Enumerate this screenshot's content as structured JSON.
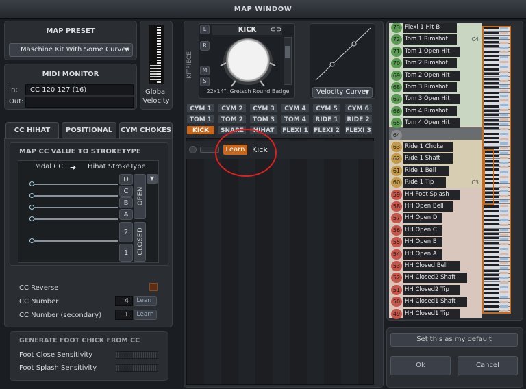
{
  "window": {
    "title": "MAP WINDOW"
  },
  "map_preset": {
    "header": "MAP PRESET",
    "selected": "Maschine Kit With Some Curves"
  },
  "midi_monitor": {
    "header": "MIDI MONITOR",
    "in_label": "In:",
    "in_value": "CC 120 127 (16)",
    "out_label": "Out:",
    "out_value": ""
  },
  "global_velocity": {
    "label_line1": "Global",
    "label_line2": "Velocity"
  },
  "tabs": [
    {
      "label": "CC HIHAT"
    },
    {
      "label": "POSITIONAL"
    },
    {
      "label": "CYM CHOKES"
    }
  ],
  "cc_map": {
    "header": "MAP CC VALUE TO STROKETYPE",
    "pedal_label": "Pedal CC",
    "hihat_label": "Hihat StrokeType",
    "letters": [
      "D",
      "C",
      "B",
      "A"
    ],
    "numbers": [
      "2",
      "1"
    ],
    "open_label": "OPEN",
    "closed_label": "CLOSED"
  },
  "cc_reverse": {
    "label": "CC Reverse"
  },
  "cc_number": {
    "label": "CC Number",
    "value": "4",
    "learn": "Learn"
  },
  "cc_number_secondary": {
    "label": "CC Number (secondary)",
    "value": "1",
    "learn": "Learn"
  },
  "foot_chick": {
    "header": "GENERATE FOOT CHICK FROM CC",
    "close_label": "Foot Close Sensitivity",
    "splash_label": "Foot Splash Sensitivity"
  },
  "kitpiece": {
    "label": "KITPIECE",
    "name": "KICK",
    "desc": "22x14\", Gretsch Round Badge",
    "buttons": [
      "L",
      "R",
      "M",
      "S"
    ]
  },
  "velocity_curve": {
    "label": "Velocity Curve"
  },
  "kit_buttons": {
    "row1": [
      "CYM 1",
      "CYM 2",
      "CYM 3",
      "CYM 4",
      "CYM 5",
      "CYM 6"
    ],
    "row2": [
      "TOM 1",
      "TOM 2",
      "TOM 3",
      "TOM 4",
      "RIDE 1",
      "RIDE 2"
    ],
    "row3": [
      "KICK",
      "SNARE",
      "HIHAT",
      "FLEXI 1",
      "FLEXI 2",
      "FLEXI 3"
    ]
  },
  "mapping_list": {
    "learn": "Learn",
    "entry": "Kick"
  },
  "note_map": [
    {
      "num": "73",
      "name": "Flexi 1 Hit B",
      "oct": ""
    },
    {
      "num": "72",
      "name": "Tom 1 Rimshot",
      "oct": "C4"
    },
    {
      "num": "71",
      "name": "Tom 1 Open Hit",
      "oct": ""
    },
    {
      "num": "70",
      "name": "Tom 2 Rimshot",
      "oct": ""
    },
    {
      "num": "69",
      "name": "Tom 2 Open Hit",
      "oct": ""
    },
    {
      "num": "68",
      "name": "Tom 3 Rimshot",
      "oct": ""
    },
    {
      "num": "67",
      "name": "Tom 3 Open Hit",
      "oct": ""
    },
    {
      "num": "66",
      "name": "Tom 4 Rimshot",
      "oct": ""
    },
    {
      "num": "65",
      "name": "Tom 4 Open Hit",
      "oct": ""
    },
    {
      "num": "64",
      "name": "",
      "oct": ""
    },
    {
      "num": "63",
      "name": "Ride 1 Choke",
      "oct": ""
    },
    {
      "num": "62",
      "name": "Ride 1 Shaft",
      "oct": ""
    },
    {
      "num": "61",
      "name": "Ride 1 Bell",
      "oct": ""
    },
    {
      "num": "60",
      "name": "Ride 1 Tip",
      "oct": "C3"
    },
    {
      "num": "59",
      "name": "HH Foot Splash",
      "oct": ""
    },
    {
      "num": "58",
      "name": "HH Open Bell",
      "oct": ""
    },
    {
      "num": "57",
      "name": "HH Open D",
      "oct": ""
    },
    {
      "num": "56",
      "name": "HH Open C",
      "oct": ""
    },
    {
      "num": "55",
      "name": "HH Open B",
      "oct": ""
    },
    {
      "num": "54",
      "name": "HH Open A",
      "oct": ""
    },
    {
      "num": "53",
      "name": "HH Closed Bell",
      "oct": ""
    },
    {
      "num": "52",
      "name": "HH Closed2 Shaft",
      "oct": ""
    },
    {
      "num": "51",
      "name": "HH Closed2 Tip",
      "oct": ""
    },
    {
      "num": "50",
      "name": "HH Closed1 Shaft",
      "oct": ""
    },
    {
      "num": "49",
      "name": "HH Closed1 Tip",
      "oct": ""
    }
  ],
  "footer": {
    "default_button": "Set this as my default",
    "ok_button": "Ok",
    "cancel_button": "Cancel"
  },
  "colors": {
    "accent": "#c8661c",
    "green": "#5a9a52",
    "tan": "#c49a4a",
    "red": "#c8554a",
    "annotation": "#e02020"
  }
}
